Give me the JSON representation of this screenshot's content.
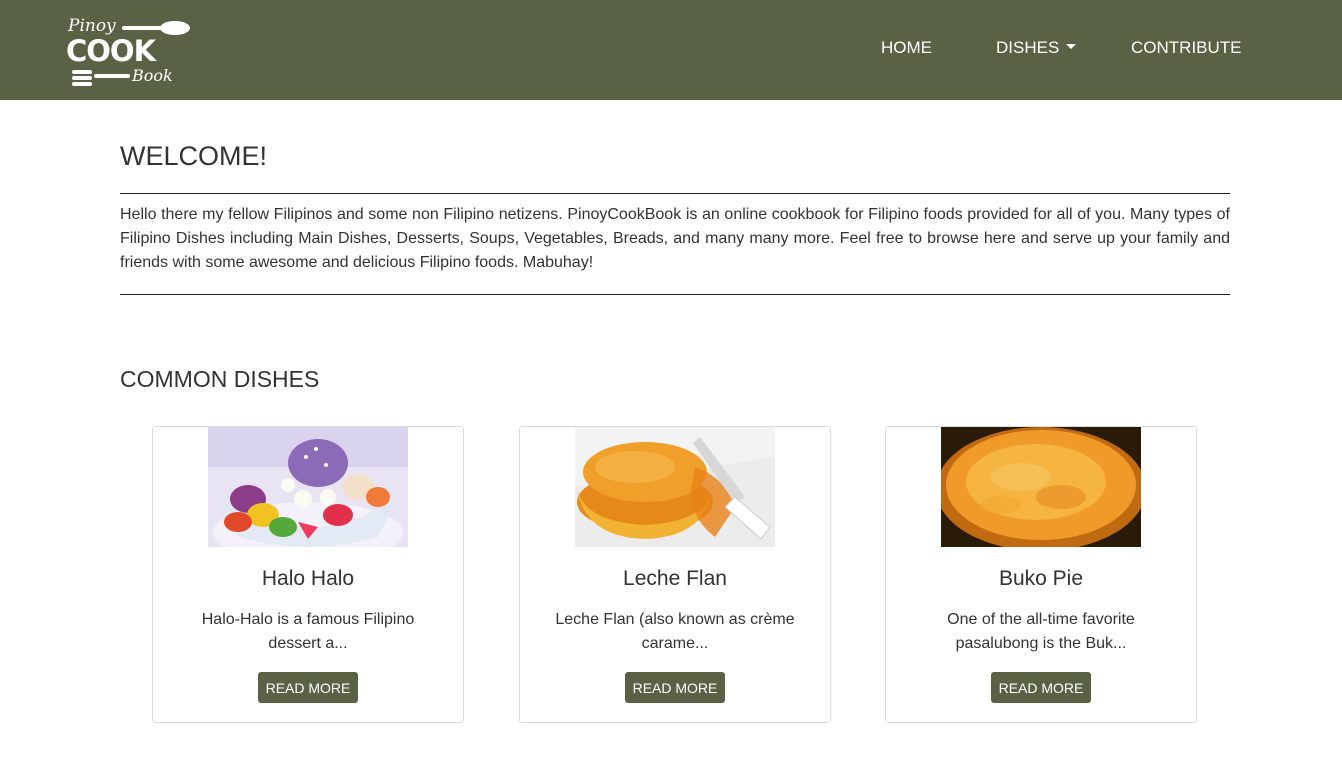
{
  "brand": {
    "logo_top": "Pinoy",
    "logo_main": "COOK",
    "logo_bottom": "Book"
  },
  "nav": {
    "home": "HOME",
    "dishes": "DISHES",
    "contribute": "CONTRIBUTE"
  },
  "welcome": {
    "title": "WELCOME!",
    "text": "Hello there my fellow Filipinos and some non Filipino netizens. PinoyCookBook is an online cookbook for Filipino foods provided for all of you. Many types of Filipino Dishes including Main Dishes, Desserts, Soups, Vegetables, Breads, and many many more. Feel free to browse here and serve up your family and friends with some awesome and delicious Filipino foods. Mabuhay!"
  },
  "common_dishes": {
    "title": "COMMON DISHES",
    "items": [
      {
        "title": "Halo Halo",
        "excerpt": "Halo-Halo is a famous Filipino dessert a...",
        "button": "READ MORE"
      },
      {
        "title": "Leche Flan",
        "excerpt": "Leche Flan (also known as crème carame...",
        "button": "READ MORE"
      },
      {
        "title": "Buko Pie",
        "excerpt": "One of the all-time favorite pasalubong is the Buk...",
        "button": "READ MORE"
      }
    ]
  },
  "colors": {
    "navbar": "#5a6245",
    "button": "#5a6245",
    "text": "#333333"
  }
}
